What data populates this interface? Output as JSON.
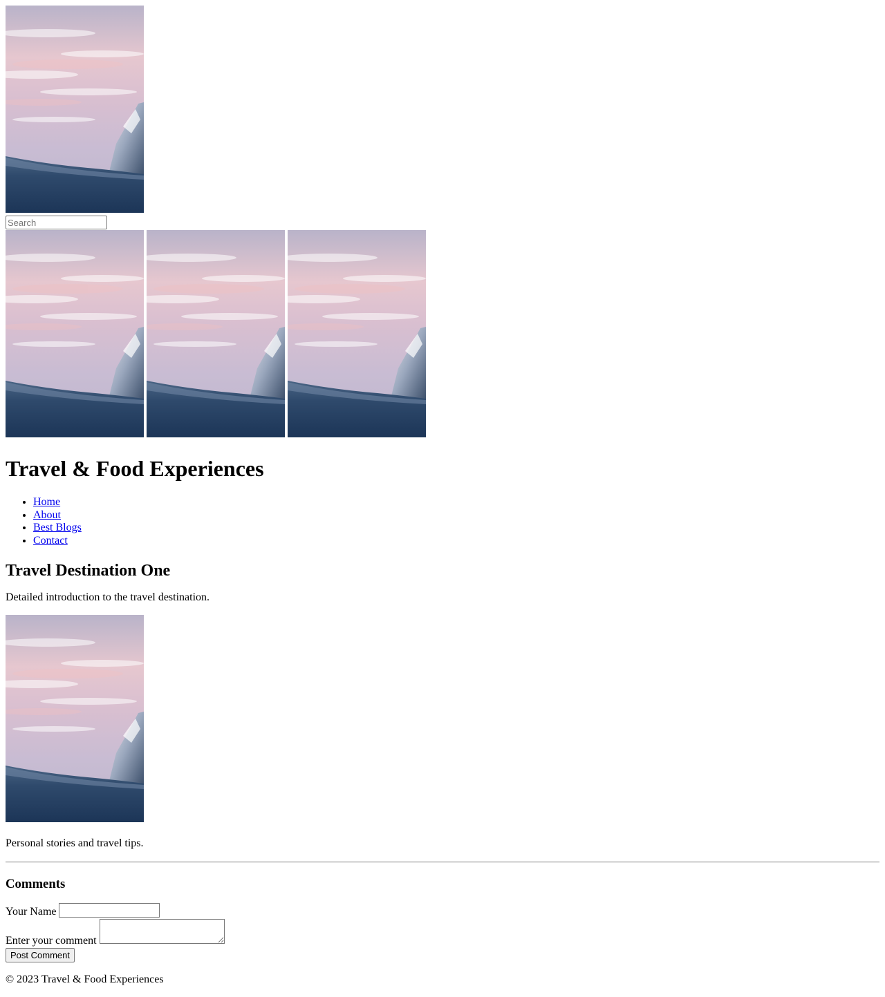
{
  "header": {
    "hero_image_alt": "Mountain peak at sunset",
    "search": {
      "placeholder": "Search",
      "value": ""
    }
  },
  "gallery": [
    {
      "alt": "Mountain peak at sunset"
    },
    {
      "alt": "Mountain peak at sunset"
    },
    {
      "alt": "Mountain peak at sunset"
    }
  ],
  "site_title": "Travel & Food Experiences",
  "nav": {
    "items": [
      {
        "label": "Home"
      },
      {
        "label": "About"
      },
      {
        "label": "Best Blogs"
      },
      {
        "label": "Contact"
      }
    ],
    "link_color": "#0000EE"
  },
  "article": {
    "title": "Travel Destination One",
    "intro": "Detailed introduction to the travel destination.",
    "image_alt": "Mountain peak at sunset",
    "body": "Personal stories and travel tips."
  },
  "comments": {
    "heading": "Comments",
    "name_label": "Your Name",
    "name_value": "",
    "comment_label": "Enter your comment",
    "comment_value": "",
    "submit_label": "Post Comment"
  },
  "footer": {
    "copyright": "© 2023 Travel & Food Experiences"
  }
}
